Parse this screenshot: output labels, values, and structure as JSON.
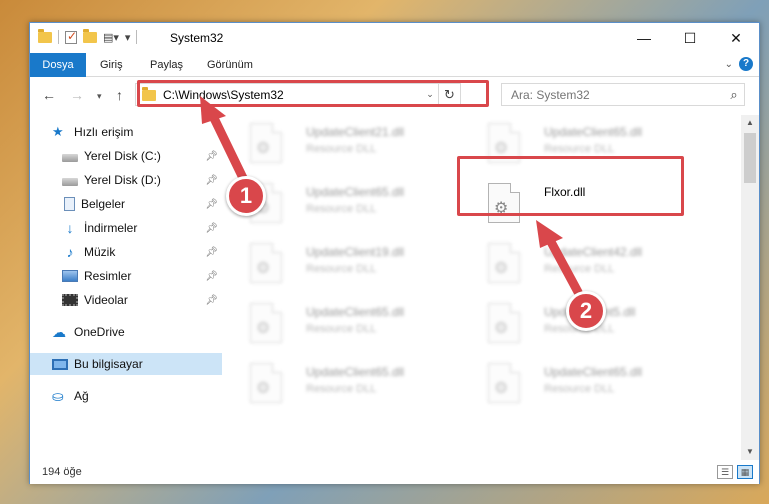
{
  "window": {
    "title": "System32"
  },
  "ribbon": {
    "tabs": [
      {
        "label": "Dosya"
      },
      {
        "label": "Giriş"
      },
      {
        "label": "Paylaş"
      },
      {
        "label": "Görünüm"
      }
    ],
    "help": "?"
  },
  "navigation": {
    "address": "C:\\Windows\\System32",
    "search_placeholder": "Ara: System32"
  },
  "sidebar": {
    "items": [
      {
        "label": "Hızlı erişim",
        "icon": "star-icon"
      },
      {
        "label": "Yerel Disk (C:)",
        "icon": "drive-icon",
        "pinned": true
      },
      {
        "label": "Yerel Disk (D:)",
        "icon": "drive-icon",
        "pinned": true
      },
      {
        "label": "Belgeler",
        "icon": "document-icon",
        "pinned": true
      },
      {
        "label": "İndirmeler",
        "icon": "download-icon",
        "pinned": true
      },
      {
        "label": "Müzik",
        "icon": "music-icon",
        "pinned": true
      },
      {
        "label": "Resimler",
        "icon": "pictures-icon",
        "pinned": true
      },
      {
        "label": "Videolar",
        "icon": "videos-icon",
        "pinned": true
      },
      {
        "label": "OneDrive",
        "icon": "cloud-icon"
      },
      {
        "label": "Bu bilgisayar",
        "icon": "computer-icon",
        "selected": true
      },
      {
        "label": "Ağ",
        "icon": "network-icon"
      }
    ]
  },
  "files": [
    {
      "name": "UpdateClient21.dll",
      "type": "Resource DLL",
      "blurred": true
    },
    {
      "name": "UpdateClient65.dll",
      "type": "Resource DLL",
      "blurred": true
    },
    {
      "name": "UpdateClient65.dll",
      "type": "Resource DLL",
      "blurred": true
    },
    {
      "name": "Flxor.dll",
      "type": "",
      "blurred": false,
      "highlighted": true
    },
    {
      "name": "UpdateClient19.dll",
      "type": "Resource DLL",
      "blurred": true
    },
    {
      "name": "UpdateClient42.dll",
      "type": "Resource DLL",
      "blurred": true
    },
    {
      "name": "UpdateClient65.dll",
      "type": "Resource DLL",
      "blurred": true
    },
    {
      "name": "UpdateClient5.dll",
      "type": "Resource DLL",
      "blurred": true
    },
    {
      "name": "UpdateClient65.dll",
      "type": "Resource DLL",
      "blurred": true
    },
    {
      "name": "UpdateClient65.dll",
      "type": "Resource DLL",
      "blurred": true
    }
  ],
  "status": {
    "item_count": "194 öğe"
  },
  "callouts": [
    {
      "number": "1"
    },
    {
      "number": "2"
    }
  ],
  "colors": {
    "accent": "#1979ca",
    "highlight": "#d9474b",
    "selection": "#cce4f7"
  }
}
